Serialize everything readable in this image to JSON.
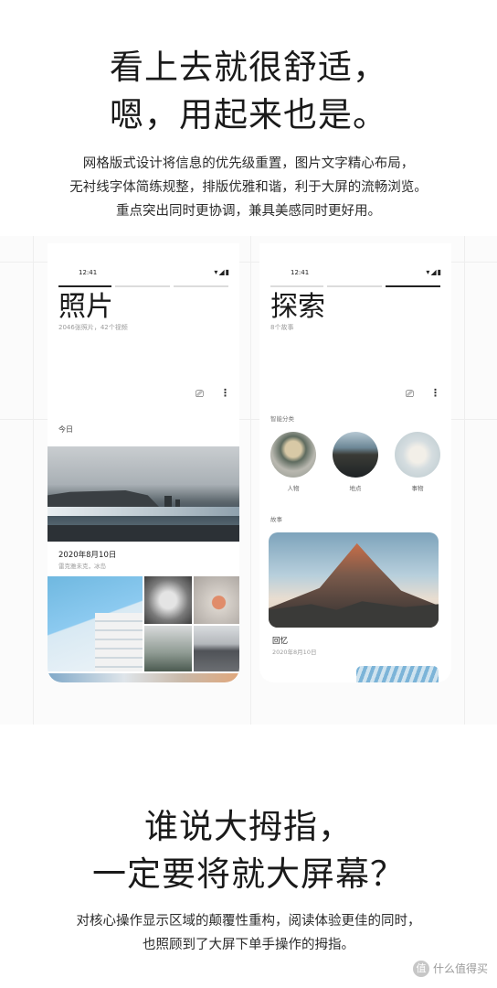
{
  "headline_top": [
    "看上去就很舒适，",
    "嗯，用起来也是。"
  ],
  "para_top": [
    "网格版式设计将信息的优先级重置，图片文字精心布局，",
    "无衬线字体简练规整，排版优雅和谐，利于大屏的流畅浏览。",
    "重点突出同时更协调，兼具美感同时更好用。"
  ],
  "photos_screen": {
    "time": "12:41",
    "status_icons": "▾◢▮",
    "title": "照片",
    "subtitle": "2046张照片，42个视频",
    "cast_icon": "cast-icon",
    "more_icon": "more-vert-icon",
    "section_today": "今日",
    "hero_date": "2020年8月10日",
    "hero_place": "雷克雅未克，冰岛"
  },
  "explore_screen": {
    "time": "12:41",
    "status_icons": "▾◢▮",
    "title": "探索",
    "subtitle": "8个故事",
    "section_categories": "智能分类",
    "categories": [
      "人物",
      "地点",
      "事物"
    ],
    "section_stories": "故事",
    "memory_title": "回忆",
    "memory_date": "2020年8月10日"
  },
  "headline_bottom": [
    "谁说大拇指，",
    "一定要将就大屏幕？"
  ],
  "para_bottom": [
    "对核心操作显示区域的颠覆性重构，阅读体验更佳的同时，",
    "也照顾到了大屏下单手操作的拇指。"
  ],
  "watermark": {
    "icon": "值",
    "text": "什么值得买"
  }
}
